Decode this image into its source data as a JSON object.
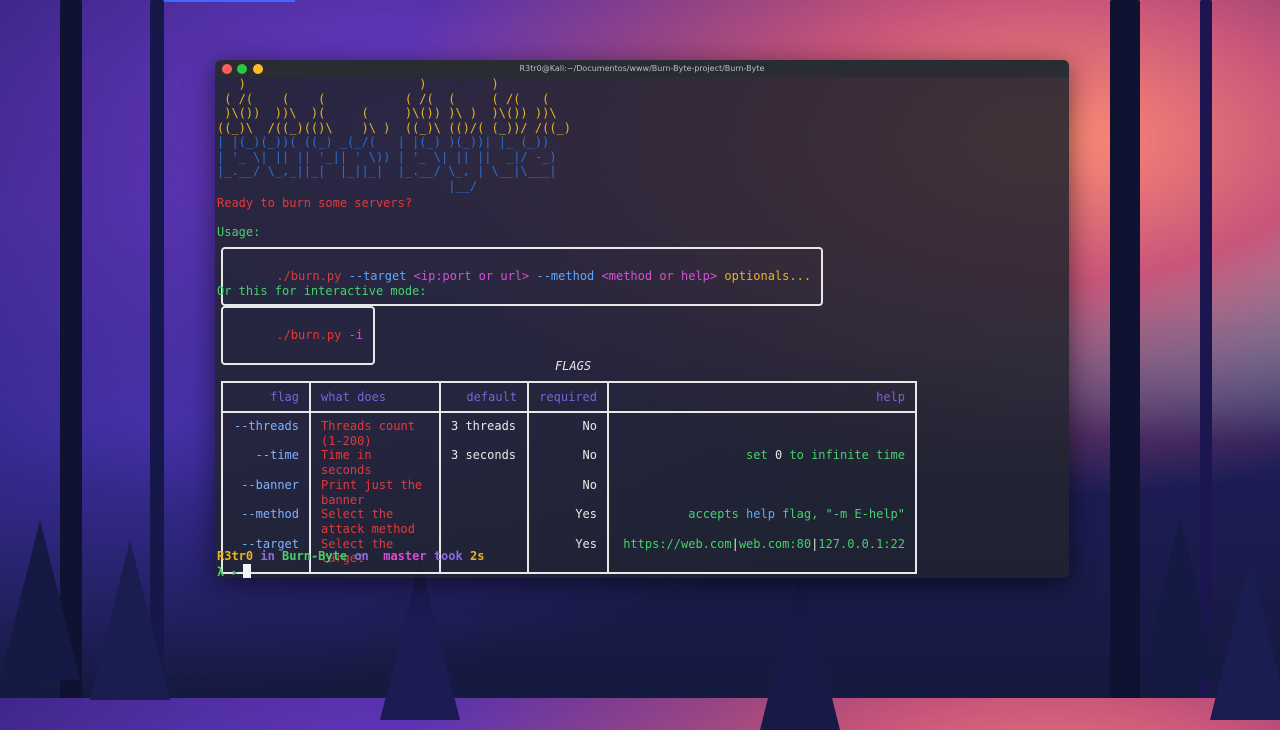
{
  "desktop": {
    "accent": "#3b6bff"
  },
  "window": {
    "title": "R3tr0@Kali:~/Documentos/www/Burn-Byte-project/Burn-Byte"
  },
  "banner": {
    "lines_yellow": [
      "   )                        )         )",
      " ( /(    (    (           ( /(  (     ( /(   (",
      " )\\())  ))\\  )(     (     )\\()) )\\ )  )\\()) ))\\",
      "((_)\\  /((_)(()\\    )\\ )  ((_)\\ (()/( (_))/ /((_)"
    ],
    "lines_blue": [
      "| |(_)(_))( ((_) _(_/(   | |(_) )(_))| |_ (_))",
      "| '_ \\| || || '_|| ' \\)) | '_ \\| || ||  _|/ -_)",
      "|_.__/ \\_,_||_|  |_||_|  |_.__/ \\_, | \\__|\\___|",
      "                                |__/"
    ]
  },
  "intro": {
    "ready": "Ready to burn some servers?",
    "usage_label": "Usage:",
    "usage_cmd": {
      "script": "./burn.py",
      "target_flag": "--target",
      "target_arg": "<ip:port or url>",
      "method_flag": "--method",
      "method_arg": "<method or help>",
      "rest": "optionals..."
    },
    "interactive_label": "Or this for interactive mode:",
    "interactive_cmd": {
      "script": "./burn.py",
      "flag": "-i"
    }
  },
  "flags_table": {
    "title": "FLAGS",
    "headers": {
      "flag": "flag",
      "what": "what does",
      "default": "default",
      "required": "required",
      "help": "help"
    },
    "rows": [
      {
        "flag": "--threads",
        "what": "Threads count (1-200)",
        "default": "3 threads",
        "required": "No",
        "help": ""
      },
      {
        "flag": "--time",
        "what": "Time in seconds",
        "default": "3 seconds",
        "required": "No",
        "help_pre": "set ",
        "help_num": "0",
        "help_post": " to infinite time"
      },
      {
        "flag": "--banner",
        "what": "Print just the banner",
        "default": "",
        "required": "No",
        "help": ""
      },
      {
        "flag": "--method",
        "what": "Select the attack method",
        "default": "",
        "required": "Yes",
        "help_pre": "accepts ",
        "help_kw": "help",
        "help_post": " flag, \"-m E-help\""
      },
      {
        "flag": "--target",
        "what": "Select the target",
        "default": "",
        "required": "Yes",
        "help_a": "https://web.com",
        "help_b": "web.com:80",
        "help_c": "127.0.0.1:22",
        "help_sep": "|"
      }
    ]
  },
  "prompt": {
    "user": "R3tr0",
    "in": "in",
    "dir": "Burn-Byte",
    "on": "on",
    "branch_icon": "",
    "branch": "master",
    "took": "took",
    "duration": "2s",
    "symbol": "λ ▸"
  }
}
